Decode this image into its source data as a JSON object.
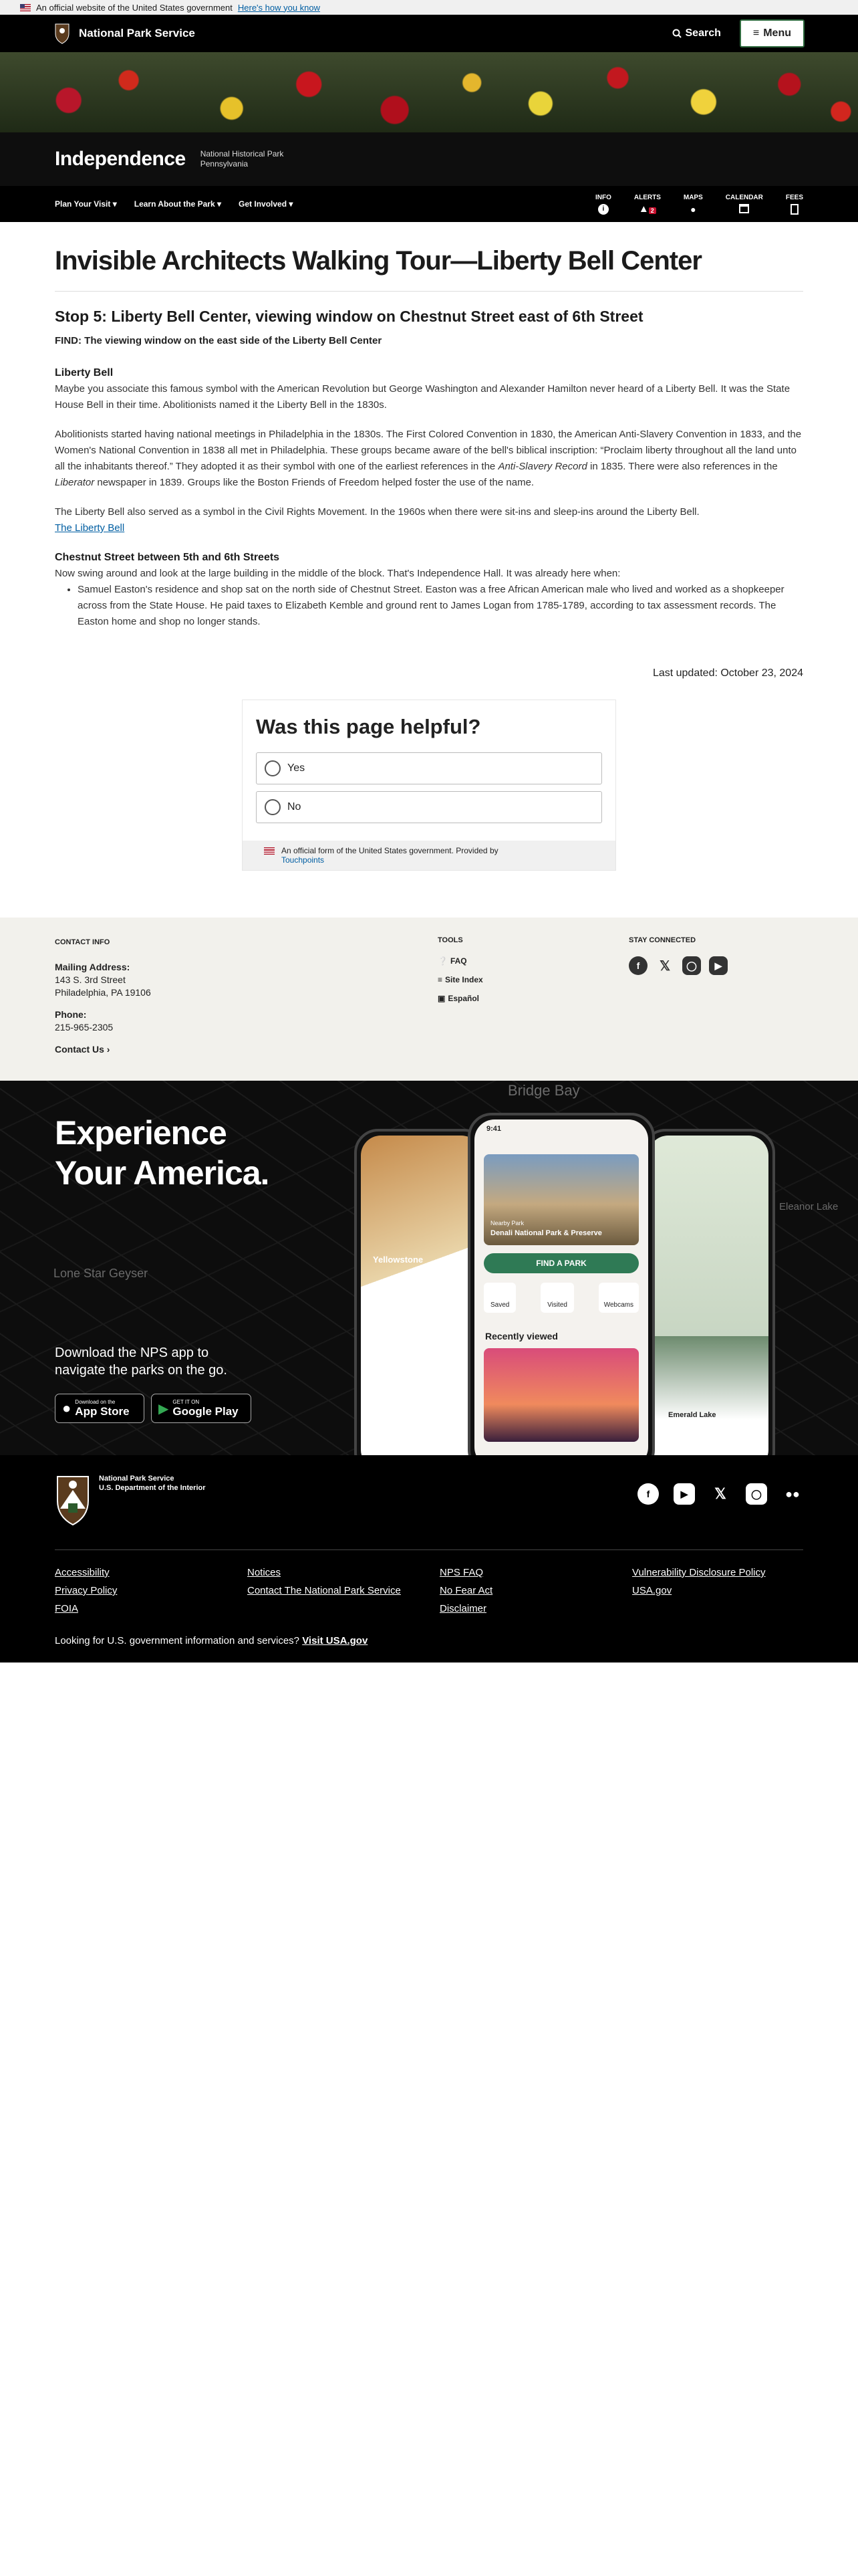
{
  "govbar": {
    "text": "An official website of the United States government",
    "link": "Here's how you know"
  },
  "topnav": {
    "brand": "National Park Service",
    "search": "Search",
    "menu": "Menu"
  },
  "park": {
    "name": "Independence",
    "desc1": "National Historical Park",
    "desc2": "Pennsylvania"
  },
  "subnav": {
    "links": [
      "Plan Your Visit",
      "Learn About the Park",
      "Get Involved"
    ],
    "tools": [
      {
        "label": "INFO",
        "icon": "info-icon"
      },
      {
        "label": "ALERTS",
        "icon": "alert-icon",
        "badge": "2"
      },
      {
        "label": "MAPS",
        "icon": "map-pin-icon"
      },
      {
        "label": "CALENDAR",
        "icon": "calendar-icon"
      },
      {
        "label": "FEES",
        "icon": "fee-icon"
      }
    ]
  },
  "page": {
    "title": "Invisible Architects Walking Tour—Liberty Bell Center",
    "stop": "Stop 5: Liberty Bell Center, viewing window on Chestnut Street east of 6th Street",
    "find": "FIND: The viewing window on the east side of the Liberty Bell Center",
    "h_bell": "Liberty Bell",
    "p1": "Maybe you associate this famous symbol with the American Revolution but George Washington and Alexander Hamilton never heard of a Liberty Bell. It was the State House Bell in their time. Abolitionists named it the Liberty Bell in the 1830s.",
    "p2a": "Abolitionists started having national meetings in Philadelphia in the 1830s. The First Colored Convention in 1830, the American Anti-Slavery Convention in 1833, and the Women's National Convention in 1838 all met in Philadelphia. These groups became aware of the bell's biblical inscription: “Proclaim liberty throughout all the land unto all the inhabitants thereof.” They adopted it as their symbol with one of the earliest references in the ",
    "p2b": "Anti-Slavery Record",
    "p2c": " in 1835. There were also references in the ",
    "p2d": "Liberator",
    "p2e": " newspaper in 1839. Groups like the Boston Friends of Freedom helped foster the use of the name.",
    "p3": "The Liberty Bell also served as a symbol in the Civil Rights Movement. In the 1960s when there were sit-ins and sleep-ins around the Liberty Bell.",
    "p3link": "The Liberty Bell",
    "h_chest": "Chestnut Street between 5th and 6th Streets",
    "p4": "Now swing around and look at the large building in the middle of the block. That's Independence Hall. It was already here when:",
    "li1": "Samuel Easton's residence and shop sat on the north side of Chestnut Street. Easton was a free African American male who lived and worked as a shopkeeper across from the State House. He paid taxes to Elizabeth Kemble and ground rent to James Logan from 1785-1789, according to tax assessment records. The Easton home and shop no longer stands.",
    "updated": "Last updated: October 23, 2024"
  },
  "helpful": {
    "title": "Was this page helpful?",
    "yes": "Yes",
    "no": "No",
    "foot": "An official form of the United States government. Provided by",
    "foot_link": "Touchpoints"
  },
  "contact": {
    "h": "CONTACT INFO",
    "mail_label": "Mailing Address:",
    "addr1": "143 S. 3rd Street",
    "addr2": "Philadelphia, PA 19106",
    "phone_label": "Phone:",
    "phone": "215-965-2305",
    "contact_us": "Contact Us"
  },
  "tools": {
    "h": "TOOLS",
    "items": [
      "FAQ",
      "Site Index",
      "Español"
    ]
  },
  "stay": {
    "h": "STAY CONNECTED"
  },
  "app": {
    "head1": "Experience",
    "head2": "Your America.",
    "dl1": "Download the NPS app to",
    "dl2": "navigate the parks on the go.",
    "appstore_small": "Download on the",
    "appstore": "App Store",
    "gplay_small": "GET IT ON",
    "gplay": "Google Play",
    "map1": "Bridge Bay",
    "map2": "Lone Star Geyser",
    "map3": "Eleanor Lake",
    "phone_time": "9:41",
    "phone_park_small": "Nearby Park",
    "phone_park": "Denali National Park & Preserve",
    "find": "FIND A PARK",
    "saved": "Saved",
    "visited": "Visited",
    "webcams": "Webcams",
    "recent": "Recently viewed",
    "left_park": "Yellowstone",
    "right_lake": "Emerald Lake"
  },
  "footer": {
    "agency1": "National Park Service",
    "agency2": "U.S. Department of the Interior",
    "links": [
      "Accessibility",
      "Notices",
      "NPS FAQ",
      "Vulnerability Disclosure Policy",
      "Privacy Policy",
      "Contact The National Park Service",
      "No Fear Act",
      "USA.gov",
      "FOIA",
      "",
      "Disclaimer",
      ""
    ],
    "usa_q": "Looking for U.S. government information and services?",
    "usa_link": "Visit USA.gov"
  }
}
